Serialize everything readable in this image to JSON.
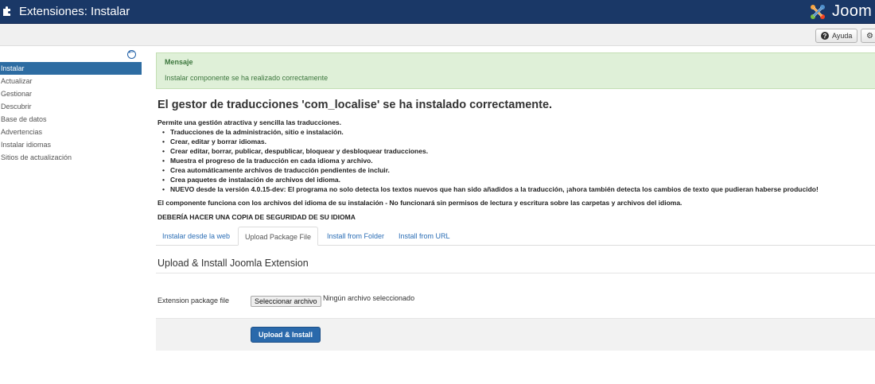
{
  "header": {
    "title": "Extensiones: Instalar",
    "logo_text": "Joom",
    "puzzle_icon": "puzzle-icon",
    "brand_color": "#1a3867"
  },
  "toolbar": {
    "help_label": "Ayuda",
    "help_icon": "question-circle-icon",
    "options_icon": "gear-icon"
  },
  "sidebar": {
    "collapse_icon": "arrow-left-circle-icon",
    "items": [
      {
        "label": "Instalar",
        "active": true
      },
      {
        "label": "Actualizar"
      },
      {
        "label": "Gestionar"
      },
      {
        "label": "Descubrir"
      },
      {
        "label": "Base de datos"
      },
      {
        "label": "Advertencias"
      },
      {
        "label": "Instalar idiomas"
      },
      {
        "label": "Sitios de actualización"
      }
    ]
  },
  "alert": {
    "heading": "Mensaje",
    "message": "Instalar componente se ha realizado correctamente",
    "color": "#dff0d8"
  },
  "content": {
    "title": "El gestor de traducciones 'com_localise' se ha instalado correctamente.",
    "intro": "Permite una gestión atractiva y sencilla las traducciones.",
    "bullets": [
      "Traducciones de la administración, sitio e instalación.",
      "Crear, editar y borrar idiomas.",
      "Crear editar, borrar, publicar, despublicar, bloquear y desbloquear traducciones.",
      "Muestra el progreso de la traducción en cada idioma y archivo.",
      "Crea automáticamente archivos de traducción pendientes de incluir.",
      "Crea paquetes de instalación de archivos del idioma.",
      "NUEVO desde la versión 4.0.15-dev: El programa no solo detecta los textos nuevos que han sido añadidos a la traducción, ¡ahora también detecta los cambios de texto que pudieran haberse producido!"
    ],
    "note1": "El componente funciona con los archivos del idioma de su instalación - No funcionará sin permisos de lectura y escritura sobre las carpetas y archivos del idioma.",
    "note2": "DEBERÍA HACER UNA COPIA DE SEGURIDAD DE SU IDIOMA"
  },
  "tabs": [
    {
      "label": "Instalar desde la web"
    },
    {
      "label": "Upload Package File",
      "active": true
    },
    {
      "label": "Install from Folder"
    },
    {
      "label": "Install from URL"
    }
  ],
  "upload": {
    "section_title": "Upload & Install Joomla Extension",
    "field_label": "Extension package file",
    "file_button": "Seleccionar archivo",
    "file_status": "Ningún archivo seleccionado",
    "submit_label": "Upload & Install",
    "accent": "#2a69ab"
  }
}
